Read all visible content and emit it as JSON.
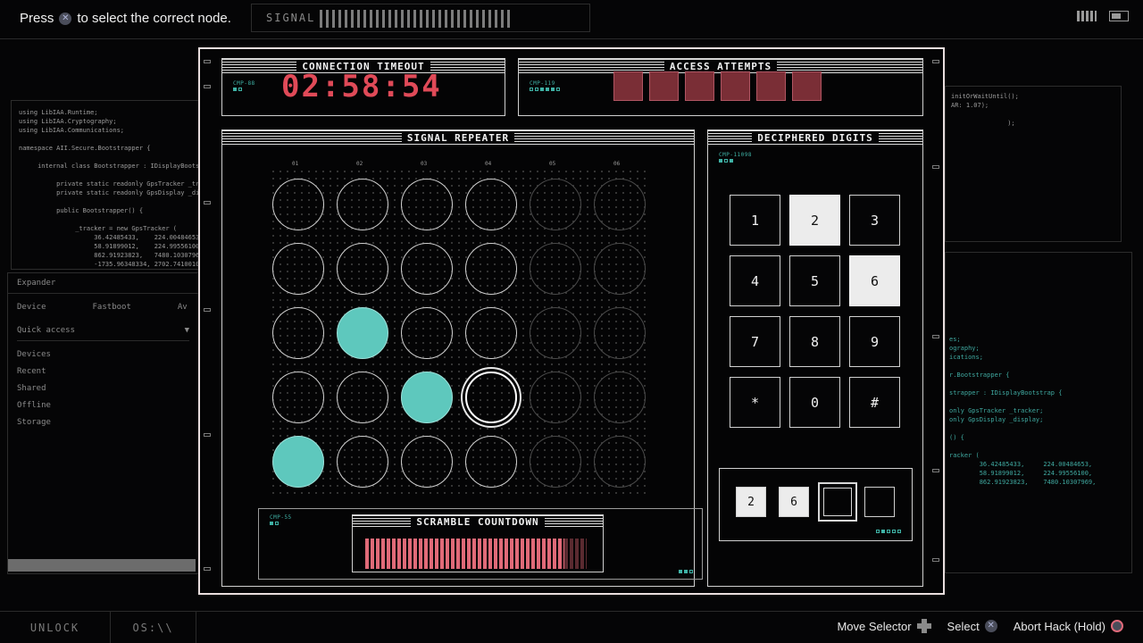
{
  "hint": {
    "before": "Press",
    "button_glyph": "✕",
    "after": "to select the correct node."
  },
  "signal": {
    "label": "SIGNAL"
  },
  "code_left": "using LibIAA.Runtime;\nusing LibIAA.Cryptography;\nusing LibIAA.Communications;\n\nnamespace AII.Secure.Bootstrapper {\n\n     internal class Bootstrapper : IDisplayBootstrap {\n\n          private static readonly GpsTracker _tracker;\n          private static readonly GpsDisplay _display;\n\n          public Bootstrapper() {\n\n               _tracker = new GpsTracker (\n                    36.42485433,    224.00484653,\n                    58.91899012,    224.99556100,\n                    862.91923823,   7480.10307969,\n                    -1735.96348334, 2702.74100103\n               );",
  "code_right_top": "initOrWaitUntil();\nAR: 1.07);\n\n               );",
  "code_right_bottom": "es;\nography;\nications;\n\nr.Bootstrapper {\n\nstrapper : IDisplayBootstrap {\n\nonly GpsTracker _tracker;\nonly GpsDisplay _display;\n\n() {\n\nracker (\n        36.42485433,     224.00484653,\n        58.91899012,     224.99556100,\n        862.91923823,    7480.10307969,",
  "explorer": {
    "header": "Expander",
    "tabs": [
      "Device",
      "Fastboot",
      "Av"
    ],
    "quick_access": "Quick access",
    "items": [
      "Devices",
      "Recent",
      "Shared",
      "Offline",
      "Storage"
    ]
  },
  "bottom_tabs": {
    "unlock": "UNLOCK",
    "os": "OS:\\\\"
  },
  "controls": {
    "move": "Move Selector",
    "select": "Select",
    "abort": "Abort Hack (Hold)"
  },
  "connection": {
    "title": "CONNECTION TIMEOUT",
    "cmp": "CMP-88",
    "time": "02:58:54"
  },
  "access": {
    "title": "ACCESS ATTEMPTS",
    "cmp": "CMP-119",
    "remaining": 6,
    "color": "#7a2e36"
  },
  "repeater": {
    "title": "SIGNAL REPEATER",
    "columns": [
      "01",
      "02",
      "03",
      "04",
      "05",
      "06"
    ],
    "rows": [
      [
        "empty",
        "empty",
        "empty",
        "empty",
        "dim",
        "dim"
      ],
      [
        "empty",
        "empty",
        "empty",
        "empty",
        "dim",
        "dim"
      ],
      [
        "empty",
        "filled",
        "empty",
        "empty",
        "dim",
        "dim"
      ],
      [
        "empty",
        "empty",
        "filled",
        "selected",
        "dim",
        "dim"
      ],
      [
        "filled",
        "empty",
        "empty",
        "empty",
        "dim",
        "dim"
      ]
    ],
    "accent": "#5ec8bd"
  },
  "scramble": {
    "title": "SCRAMBLE COUNTDOWN",
    "cmp": "CMP-55",
    "progress": 0.9,
    "color": "#e06a78"
  },
  "deciphered": {
    "title": "DECIPHERED DIGITS",
    "cmp": "CMP-11098",
    "keys": [
      {
        "label": "1",
        "lit": false
      },
      {
        "label": "2",
        "lit": true
      },
      {
        "label": "3",
        "lit": false
      },
      {
        "label": "4",
        "lit": false
      },
      {
        "label": "5",
        "lit": false
      },
      {
        "label": "6",
        "lit": true
      },
      {
        "label": "7",
        "lit": false
      },
      {
        "label": "8",
        "lit": false
      },
      {
        "label": "9",
        "lit": false
      },
      {
        "label": "*",
        "lit": false
      },
      {
        "label": "0",
        "lit": false
      },
      {
        "label": "#",
        "lit": false
      }
    ],
    "code_slots": [
      "2",
      "6",
      "",
      ""
    ]
  }
}
